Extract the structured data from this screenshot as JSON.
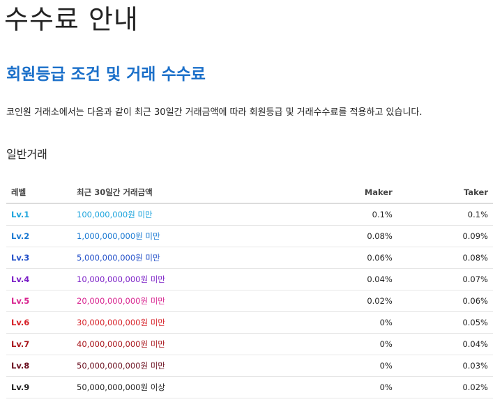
{
  "page_title": "수수료 안내",
  "section_title": "회원등급 조건 및 거래 수수료",
  "description": "코인원 거래소에서는 다음과 같이 최근 30일간 거래금액에 따라 회원등급 및 거래수수료를 적용하고 있습니다.",
  "sub_title": "일반거래",
  "table": {
    "headers": {
      "level": "레벨",
      "amount": "최근 30일간 거래금액",
      "maker": "Maker",
      "taker": "Taker"
    },
    "rows": [
      {
        "level": "Lv.1",
        "amount": "100,000,000원 미만",
        "maker": "0.1%",
        "taker": "0.1%",
        "color": "#1aa3dc"
      },
      {
        "level": "Lv.2",
        "amount": "1,000,000,000원 미만",
        "maker": "0.08%",
        "taker": "0.09%",
        "color": "#1a79d2"
      },
      {
        "level": "Lv.3",
        "amount": "5,000,000,000원 미만",
        "maker": "0.06%",
        "taker": "0.08%",
        "color": "#2451c9"
      },
      {
        "level": "Lv.4",
        "amount": "10,000,000,000원 미만",
        "maker": "0.04%",
        "taker": "0.07%",
        "color": "#7b1fc7"
      },
      {
        "level": "Lv.5",
        "amount": "20,000,000,000원 미만",
        "maker": "0.02%",
        "taker": "0.06%",
        "color": "#d8238f"
      },
      {
        "level": "Lv.6",
        "amount": "30,000,000,000원 미만",
        "maker": "0%",
        "taker": "0.05%",
        "color": "#d61f26"
      },
      {
        "level": "Lv.7",
        "amount": "40,000,000,000원 미만",
        "maker": "0%",
        "taker": "0.04%",
        "color": "#a8161c"
      },
      {
        "level": "Lv.8",
        "amount": "50,000,000,000원 미만",
        "maker": "0%",
        "taker": "0.03%",
        "color": "#6b1020"
      },
      {
        "level": "Lv.9",
        "amount": "50,000,000,000원 이상",
        "maker": "0%",
        "taker": "0.02%",
        "color": "#222222"
      }
    ]
  }
}
